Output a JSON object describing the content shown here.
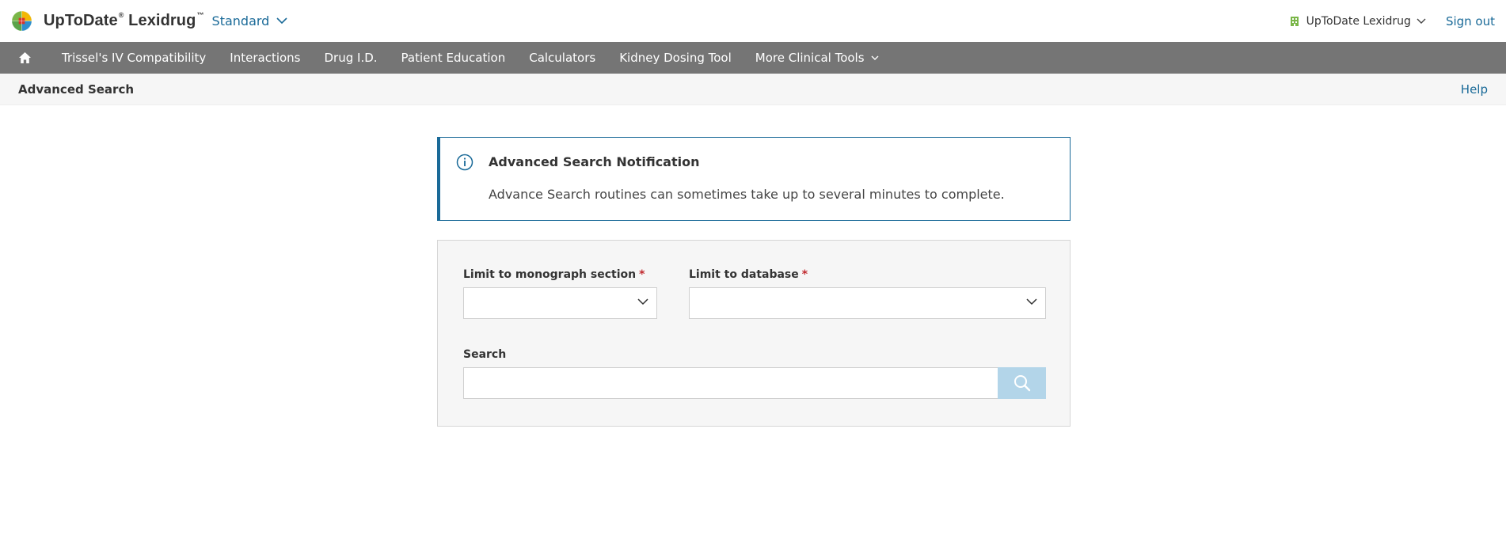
{
  "header": {
    "product_name": "UpToDate",
    "product_reg": "®",
    "product_sub": "Lexidrug",
    "product_tm": "™",
    "edition": "Standard",
    "account_label": "UpToDate Lexidrug",
    "signout_label": "Sign out"
  },
  "nav": {
    "items": [
      {
        "label": "Trissel's IV Compatibility"
      },
      {
        "label": "Interactions"
      },
      {
        "label": "Drug I.D."
      },
      {
        "label": "Patient Education"
      },
      {
        "label": "Calculators"
      },
      {
        "label": "Kidney Dosing Tool"
      },
      {
        "label": "More Clinical Tools"
      }
    ]
  },
  "subheader": {
    "title": "Advanced Search",
    "help_label": "Help"
  },
  "notification": {
    "title": "Advanced Search Notification",
    "body": "Advance Search routines can sometimes take up to several minutes to complete."
  },
  "form": {
    "monograph_label": "Limit to monograph section",
    "monograph_value": "",
    "database_label": "Limit to database",
    "database_value": "",
    "required_marker": "*",
    "search_label": "Search",
    "search_value": "",
    "search_placeholder": ""
  },
  "colors": {
    "brand_blue": "#1a6a98",
    "nav_bg": "#757575",
    "search_button": "#b3d5e9",
    "required": "#c0282d",
    "account_icon": "#7ab648"
  }
}
